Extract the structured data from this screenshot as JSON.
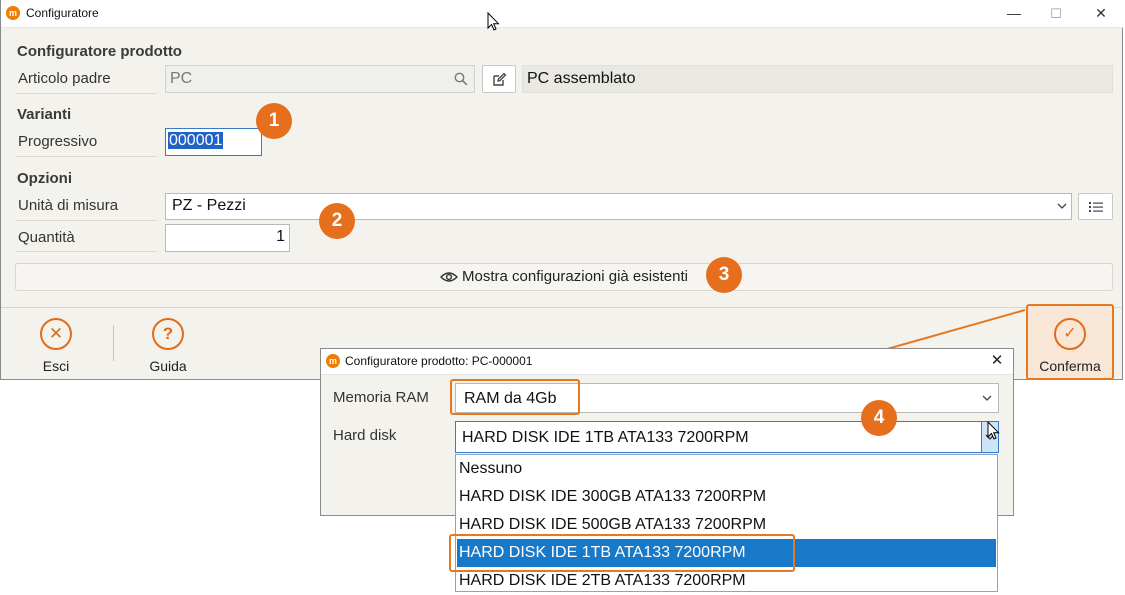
{
  "window": {
    "title": "Configuratore",
    "minimize": "—",
    "maximize": "☐",
    "close": "✕"
  },
  "product": {
    "section_title": "Configuratore prodotto",
    "parent_label": "Articolo padre",
    "parent_value": "PC",
    "parent_description": "PC assemblato"
  },
  "variants": {
    "section_title": "Varianti",
    "progressive_label": "Progressivo",
    "progressive_value": "000001"
  },
  "options": {
    "section_title": "Opzioni",
    "uom_label": "Unità di misura",
    "uom_value": "PZ - Pezzi",
    "qty_label": "Quantità",
    "qty_value": "1",
    "show_configs_label": "Mostra configurazioni già esistenti"
  },
  "toolbar": {
    "exit_label": "Esci",
    "help_label": "Guida",
    "confirm_label": "Conferma"
  },
  "markers": {
    "m1": "1",
    "m2": "2",
    "m3": "3",
    "m4": "4"
  },
  "dialog": {
    "title": "Configuratore prodotto: PC-000001",
    "close": "✕",
    "ram_label": "Memoria RAM",
    "ram_value": "RAM da 4Gb",
    "hd_label": "Hard disk",
    "hd_value": "HARD DISK IDE 1TB ATA133 7200RPM",
    "hd_options": [
      "Nessuno",
      "HARD DISK IDE 300GB ATA133 7200RPM",
      "HARD DISK IDE 500GB ATA133 7200RPM",
      "HARD DISK IDE 1TB ATA133 7200RPM",
      "HARD DISK IDE 2TB ATA133 7200RPM"
    ],
    "selected_index": 3
  },
  "colors": {
    "accent": "#e26b1a",
    "selection": "#1879c9"
  }
}
